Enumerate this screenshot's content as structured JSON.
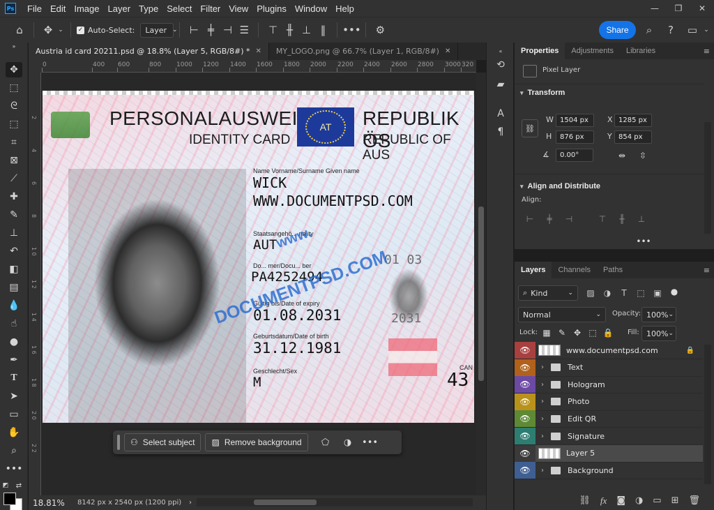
{
  "app": {
    "logo_text": "Ps",
    "menus": [
      "File",
      "Edit",
      "Image",
      "Layer",
      "Type",
      "Select",
      "Filter",
      "View",
      "Plugins",
      "Window",
      "Help"
    ],
    "window_controls": [
      "minimize",
      "restore",
      "close"
    ]
  },
  "options_bar": {
    "auto_select_label": "Auto-Select:",
    "auto_select_target": "Layer",
    "share_label": "Share"
  },
  "tabs": [
    {
      "label": "Austria id card 20211.psd @ 18.8% (Layer 5, RGB/8#) *",
      "active": true
    },
    {
      "label": "MY_LOGO.png @ 66.7% (Layer 1, RGB/8#)",
      "active": false
    }
  ],
  "ruler": {
    "h_ticks": [
      "0",
      "400",
      "600",
      "800",
      "1000",
      "1200",
      "1400",
      "1600",
      "1800",
      "2000",
      "2200",
      "2400",
      "2600",
      "2800",
      "3000",
      "320"
    ],
    "v_ticks": [
      "2",
      "4",
      "6",
      "8",
      "1 0",
      "1 2",
      "1 4",
      "1 6",
      "1 8",
      "2 0",
      "2 2"
    ]
  },
  "card": {
    "title_de": "PERSONALAUSWEIS",
    "title_en": "IDENTITY CARD",
    "country_de": "REPUBLIK ÖS",
    "country_en": "REPUBLIC OF AUS",
    "flag_code": "AT",
    "name_label": "Name Vorname/Surname Given name",
    "surname": "WICK",
    "given_name": "WWW.DOCUMENTPSD.COM",
    "nationality_label": "Staatsangehö... nality",
    "nationality": "AUT",
    "docnum_label": "Do... mer/Docu... ber",
    "docnum": "PA4252494",
    "expiry_label": "Gültig bis/Date of expiry",
    "expiry": "01.08.2031",
    "dob_label": "Geburtsdatum/Date of birth",
    "dob": "31.12.1981",
    "sex_label": "Geschlecht/Sex",
    "sex": "M",
    "can_label": "CAN",
    "can_value": "43",
    "ghost_date": "01 03",
    "ghost_year": "2031",
    "watermark_www": "www.",
    "watermark_main": "DOCUMENTPSD.COM"
  },
  "contextual_bar": {
    "select_subject": "Select subject",
    "remove_background": "Remove background"
  },
  "status": {
    "zoom": "18.81%",
    "doc_size": "8142 px x 2540 px (1200 ppi)"
  },
  "properties": {
    "tabs": [
      "Properties",
      "Adjustments",
      "Libraries"
    ],
    "layer_type": "Pixel Layer",
    "transform_title": "Transform",
    "w_label": "W",
    "w_value": "1504 px",
    "h_label": "H",
    "h_value": "876 px",
    "x_label": "X",
    "x_value": "1285 px",
    "y_label": "Y",
    "y_value": "854 px",
    "angle_value": "0.00°",
    "align_title": "Align and Distribute",
    "align_label": "Align:"
  },
  "layers_panel": {
    "tabs": [
      "Layers",
      "Channels",
      "Paths"
    ],
    "filter_kind": "Kind",
    "blend_mode": "Normal",
    "opacity_label": "Opacity:",
    "opacity_value": "100%",
    "lock_label": "Lock:",
    "fill_label": "Fill:",
    "fill_value": "100%",
    "layers": [
      {
        "name": "www.documentpsd.com",
        "color": "#a8403f",
        "type": "thumb",
        "locked": true
      },
      {
        "name": "Text",
        "color": "#b0611b",
        "type": "folder"
      },
      {
        "name": "Hologram",
        "color": "#6c4aa3",
        "type": "folder"
      },
      {
        "name": "Photo",
        "color": "#b9921b",
        "type": "folder"
      },
      {
        "name": "Edit QR",
        "color": "#5e8a36",
        "type": "folder"
      },
      {
        "name": "Signature",
        "color": "#2e7d72",
        "type": "folder"
      },
      {
        "name": "Layer 5",
        "color": "#3a3a3a",
        "type": "thumb",
        "selected": true
      },
      {
        "name": "Background",
        "color": "#3f5f92",
        "type": "folder"
      }
    ]
  }
}
